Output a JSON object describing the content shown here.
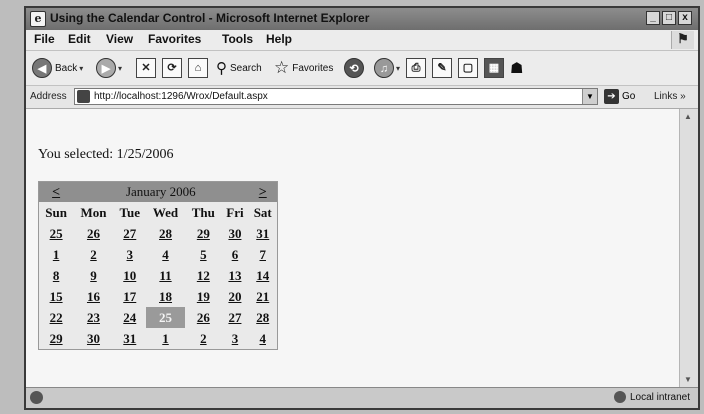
{
  "window": {
    "title": "Using the Calendar Control - Microsoft Internet Explorer",
    "buttons": {
      "minimize": "_",
      "maximize": "□",
      "close": "x"
    }
  },
  "menu": {
    "items": [
      "File",
      "Edit",
      "View",
      "Favorites",
      "Tools",
      "Help"
    ]
  },
  "toolbar": {
    "back": "Back",
    "search": "Search",
    "favorites": "Favorites"
  },
  "address": {
    "label": "Address",
    "url": "http://localhost:1296/Wrox/Default.aspx",
    "go": "Go",
    "links": "Links"
  },
  "page": {
    "selected_text": "You selected: 1/25/2006"
  },
  "calendar": {
    "prev": "<",
    "next": ">",
    "month": "January 2006",
    "weekdays": [
      "Sun",
      "Mon",
      "Tue",
      "Wed",
      "Thu",
      "Fri",
      "Sat"
    ],
    "weeks": [
      [
        "25",
        "26",
        "27",
        "28",
        "29",
        "30",
        "31"
      ],
      [
        "1",
        "2",
        "3",
        "4",
        "5",
        "6",
        "7"
      ],
      [
        "8",
        "9",
        "10",
        "11",
        "12",
        "13",
        "14"
      ],
      [
        "15",
        "16",
        "17",
        "18",
        "19",
        "20",
        "21"
      ],
      [
        "22",
        "23",
        "24",
        "25",
        "26",
        "27",
        "28"
      ],
      [
        "29",
        "30",
        "31",
        "1",
        "2",
        "3",
        "4"
      ]
    ],
    "selected_week": 4,
    "selected_day": 3
  },
  "status": {
    "zone": "Local intranet"
  }
}
